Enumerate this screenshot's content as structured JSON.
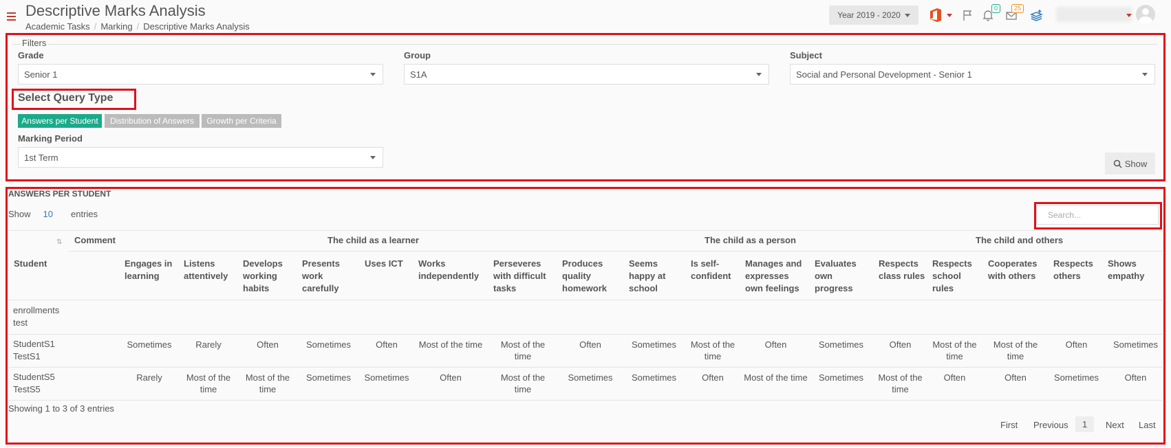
{
  "header": {
    "title": "Descriptive Marks Analysis",
    "breadcrumb": [
      "Academic Tasks",
      "Marking",
      "Descriptive Marks Analysis"
    ],
    "year": "Year 2019 - 2020",
    "notifications_count": "0",
    "messages_count": "25"
  },
  "filters": {
    "legend": "Filters",
    "grade_label": "Grade",
    "grade_value": "Senior 1",
    "group_label": "Group",
    "group_value": "S1A",
    "subject_label": "Subject",
    "subject_value": "Social and Personal Development - Senior 1",
    "query_type_title": "Select Query Type",
    "query_types": [
      "Answers per Student",
      "Distribution of Answers",
      "Growth per Criteria"
    ],
    "active_query": "Answers per Student",
    "marking_period_label": "Marking Period",
    "marking_period_value": "1st Term",
    "show_button": "Show"
  },
  "results": {
    "title": "ANSWERS PER STUDENT",
    "show_label": "Show",
    "entries_value": "10",
    "entries_label": "entries",
    "search_placeholder": "Search...",
    "group_headers": {
      "comment": "Comment",
      "learner": "The child as a learner",
      "person": "The child as a person",
      "others": "The child and others"
    },
    "student_header": "Student",
    "columns": [
      "Engages in learning",
      "Listens attentively",
      "Develops working habits",
      "Presents work carefully",
      "Uses ICT",
      "Works independently",
      "Perseveres with difficult tasks",
      "Produces quality homework",
      "Seems happy at school",
      "Is self-confident",
      "Manages and expresses own feelings",
      "Evaluates own progress",
      "Respects class rules",
      "Respects school rules",
      "Cooperates with others",
      "Respects others",
      "Shows empathy"
    ],
    "rows": [
      {
        "student": "enrollments test",
        "values": [
          "",
          "",
          "",
          "",
          "",
          "",
          "",
          "",
          "",
          "",
          "",
          "",
          "",
          "",
          "",
          "",
          ""
        ]
      },
      {
        "student": "StudentS1 TestS1",
        "values": [
          "Sometimes",
          "Rarely",
          "Often",
          "Sometimes",
          "Often",
          "Most of the time",
          "Most of the time",
          "Often",
          "Sometimes",
          "Most of the time",
          "Often",
          "Sometimes",
          "Often",
          "Most of the time",
          "Most of the time",
          "Often",
          "Sometimes"
        ]
      },
      {
        "student": "StudentS5 TestS5",
        "values": [
          "Rarely",
          "Most of the time",
          "Most of the time",
          "Sometimes",
          "Sometimes",
          "Often",
          "Most of the time",
          "Sometimes",
          "Sometimes",
          "Often",
          "Most of the time",
          "Sometimes",
          "Most of the time",
          "Often",
          "Often",
          "Sometimes",
          "Often"
        ]
      }
    ],
    "info": "Showing 1 to 3 of 3 entries",
    "pagination": {
      "first": "First",
      "previous": "Previous",
      "current": "1",
      "next": "Next",
      "last": "Last"
    }
  }
}
